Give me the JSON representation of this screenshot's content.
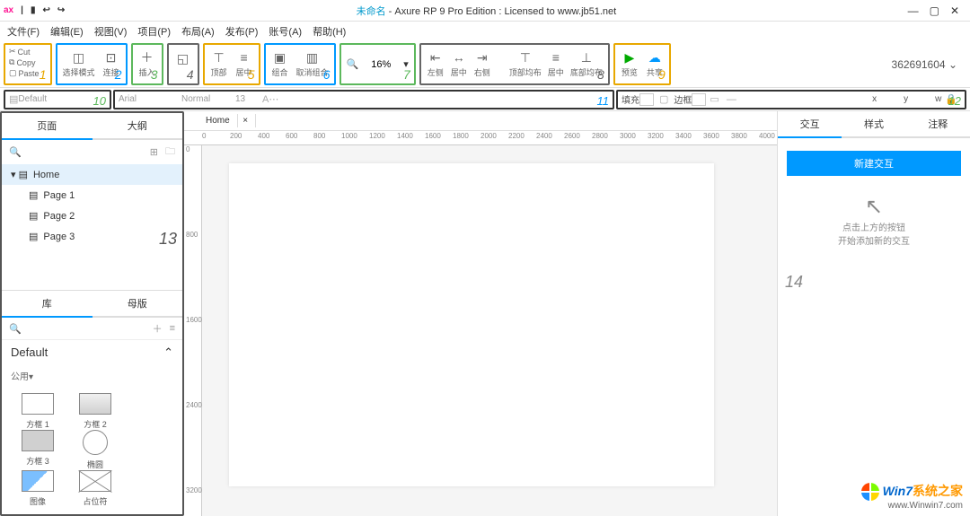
{
  "title": {
    "doc": "未命名",
    "app": "Axure RP 9 Pro Edition : Licensed to www.jb51.net"
  },
  "menu": [
    "文件(F)",
    "编辑(E)",
    "视图(V)",
    "项目(P)",
    "布局(A)",
    "发布(P)",
    "账号(A)",
    "帮助(H)"
  ],
  "toolbar": {
    "cut": "Cut",
    "copy": "Copy",
    "paste": "Paste",
    "select": "选择模式",
    "connect": "连接",
    "insert": "插入",
    "zoom": "16%",
    "align_top": "顶部",
    "align_mid": "居中",
    "group": "组合",
    "ungroup": "取消组合",
    "al_left": "左侧",
    "al_center": "居中",
    "al_right": "右侧",
    "dist_top": "顶部均布",
    "dist_mid": "居中",
    "dist_bot": "底部均布",
    "preview": "预览",
    "share": "共享"
  },
  "account": "362691604",
  "stylebar": {
    "style": "Default",
    "font": "Arial",
    "weight": "Normal",
    "size": "13",
    "fill": "填充",
    "border": "边框",
    "x": "x",
    "y": "y",
    "w": "w"
  },
  "left": {
    "tab_pages": "页面",
    "tab_outline": "大纲",
    "tree": {
      "home": "Home",
      "p1": "Page 1",
      "p2": "Page 2",
      "p3": "Page 3"
    },
    "tab_lib": "库",
    "tab_master": "母版",
    "libname": "Default",
    "libcat": "公用▾",
    "shapes": {
      "r1": "方框 1",
      "r2": "方框 2",
      "r3": "方框 3",
      "circ": "椭圆",
      "img": "图像",
      "plc": "占位符"
    }
  },
  "canvas": {
    "tab": "Home",
    "ticks_h": [
      "0",
      "200",
      "400",
      "600",
      "800",
      "1000",
      "1200",
      "1400",
      "1600",
      "1800",
      "2000",
      "2200",
      "2400",
      "2600",
      "2800",
      "3000",
      "3200",
      "3400",
      "3600",
      "3800",
      "4000"
    ],
    "ticks_v": [
      "0",
      "800",
      "1600",
      "2400",
      "3200"
    ]
  },
  "right": {
    "tab_int": "交互",
    "tab_style": "样式",
    "tab_notes": "注释",
    "new": "新建交互",
    "hint1": "点击上方的按钮",
    "hint2": "开始添加新的交互"
  },
  "annotations": {
    "n1": "1",
    "n2": "2",
    "n3": "3",
    "n4": "4",
    "n5": "5",
    "n6": "6",
    "n7": "7",
    "n8": "8",
    "n9": "9",
    "n10": "10",
    "n11": "11",
    "n12": "12",
    "n13": "13",
    "n14": "14"
  },
  "watermark": {
    "brand_a": "Win7",
    "brand_b": "系统之家",
    "url": "www.Winwin7.com"
  }
}
